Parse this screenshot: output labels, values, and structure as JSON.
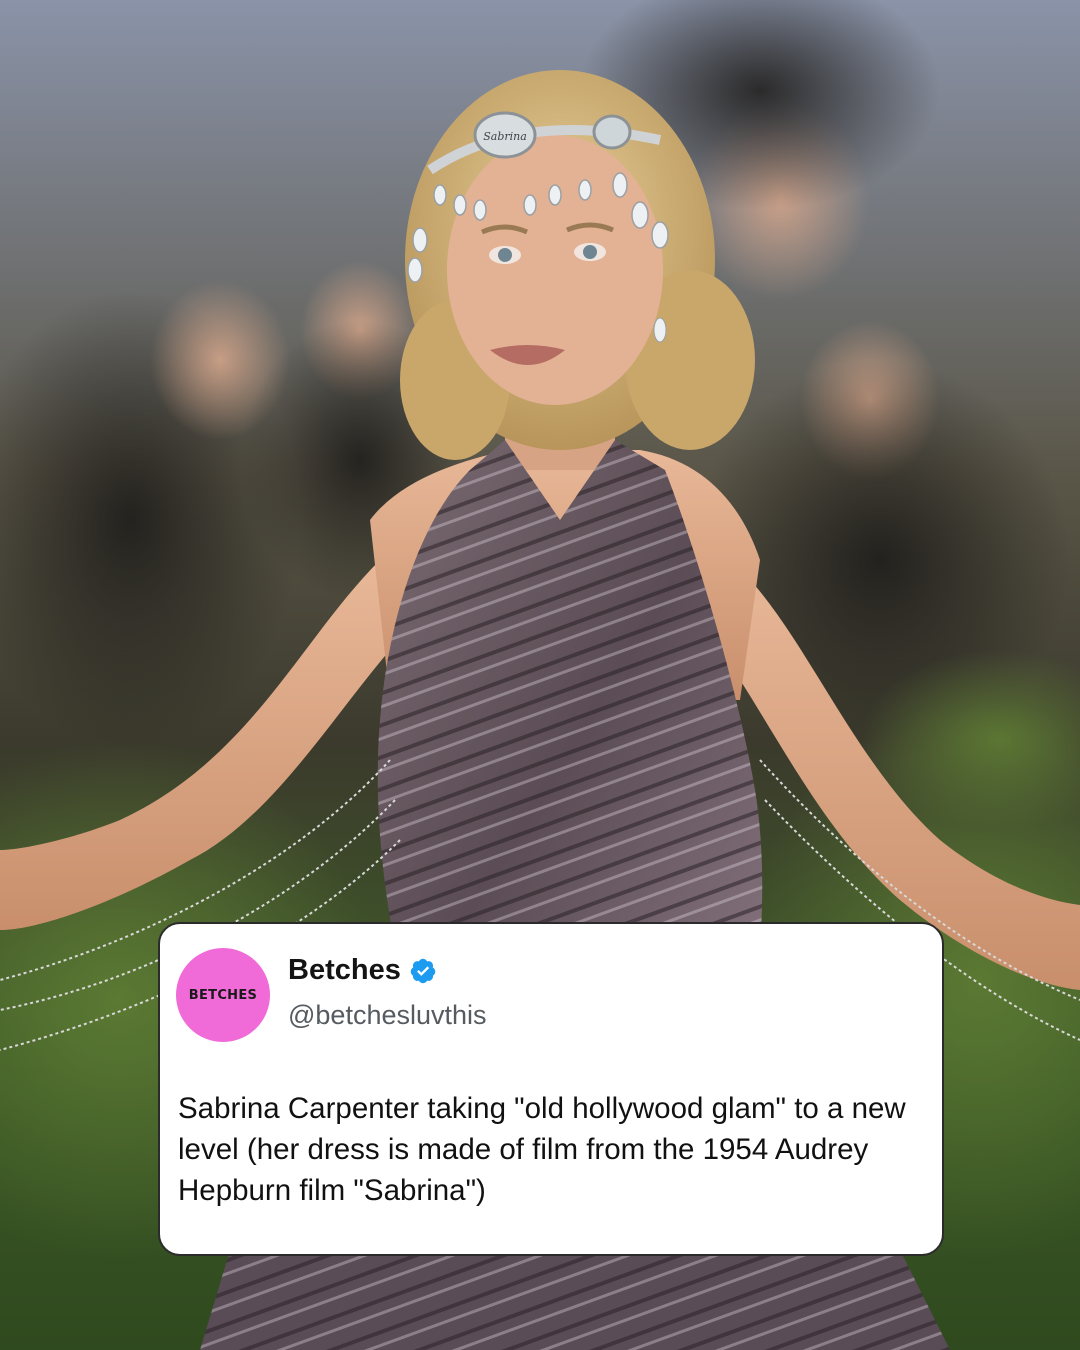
{
  "tweet": {
    "avatar_text": "BETCHES",
    "display_name": "Betches",
    "verified_icon": "verified-badge-icon",
    "handle": "@betchesluvthis",
    "text": "Sabrina Carpenter taking \"old hollywood glam\" to a new level (her dress is made of film from the 1954 Audrey Hepburn film \"Sabrina\")"
  },
  "photo": {
    "headpiece_text": "Sabrina"
  },
  "colors": {
    "avatar_bg": "#f06ad8",
    "verified_blue": "#1d9bf0",
    "card_bg": "#ffffff"
  }
}
